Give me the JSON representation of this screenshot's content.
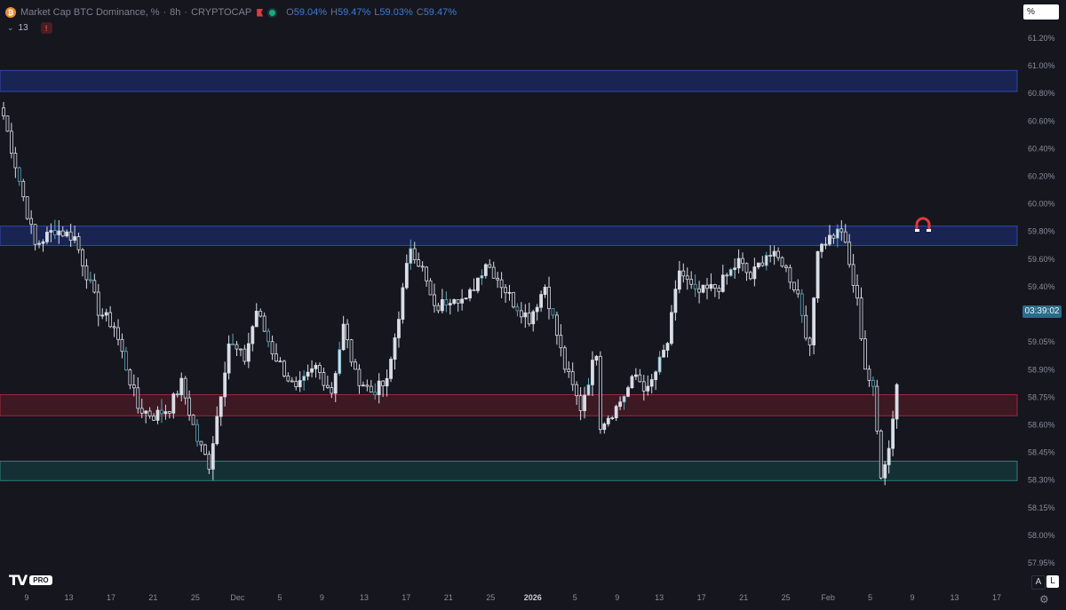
{
  "header": {
    "coin_glyph": "₿",
    "title": "Market Cap BTC Dominance, %",
    "separator_1": "·",
    "timeframe": "8h",
    "separator_2": "·",
    "exchange": "CRYPTOCAP",
    "ohlc": {
      "o_label": "O",
      "o_value": "59.04%",
      "h_label": "H",
      "h_value": "59.47%",
      "l_label": "L",
      "l_value": "59.03%",
      "c_label": "C",
      "c_value": "59.47%"
    },
    "indicator_count": "13",
    "warning_glyph": "!"
  },
  "scale_mode_label": "%",
  "current_price_label": "03:39:02",
  "logo": {
    "mark": "TV",
    "badge": "PRO"
  },
  "controls": {
    "auto_label": "A",
    "log_label": "L",
    "settings_glyph": "⚙"
  },
  "colors": {
    "background": "#15161e",
    "candle": "#d8dde6",
    "candle_dim": "#5fa5ba",
    "zone_blue_fill": "#1b2a66",
    "zone_blue_border": "#3046b0",
    "zone_red_fill": "#4a1b25",
    "zone_red_border": "#a02a36",
    "zone_teal_fill": "#16393c",
    "zone_teal_border": "#2f7f7e",
    "magnet": "#e0393e"
  },
  "chart_data": {
    "type": "candlestick",
    "title": "Market Cap BTC Dominance, %",
    "xlabel": "",
    "ylabel": "",
    "ylim": [
      57.85,
      61.3
    ],
    "y_ticks": [
      "61.20%",
      "61.00%",
      "60.80%",
      "60.60%",
      "60.40%",
      "60.20%",
      "60.00%",
      "59.80%",
      "59.60%",
      "59.40%",
      "59.20%",
      "59.05%",
      "58.90%",
      "58.75%",
      "58.60%",
      "58.45%",
      "58.30%",
      "58.15%",
      "58.00%",
      "57.95%"
    ],
    "x_ticks": [
      "9",
      "13",
      "17",
      "21",
      "25",
      "Dec",
      "5",
      "9",
      "13",
      "17",
      "21",
      "25",
      "2026",
      "5",
      "9",
      "13",
      "17",
      "21",
      "25",
      "Feb",
      "5",
      "9",
      "13",
      "17"
    ],
    "zones": [
      {
        "name": "resistance-top",
        "low": 60.9,
        "high": 61.03,
        "color": "blue"
      },
      {
        "name": "resistance-mid",
        "low": 59.95,
        "high": 60.07,
        "color": "blue"
      },
      {
        "name": "support-mid",
        "low": 58.9,
        "high": 59.03,
        "color": "red"
      },
      {
        "name": "support-low",
        "low": 58.5,
        "high": 58.62,
        "color": "teal"
      }
    ],
    "path_knots": [
      [
        0,
        60.75
      ],
      [
        4,
        60.35
      ],
      [
        8,
        59.95
      ],
      [
        13,
        60.05
      ],
      [
        18,
        60.0
      ],
      [
        24,
        59.55
      ],
      [
        28,
        59.45
      ],
      [
        34,
        58.95
      ],
      [
        38,
        58.9
      ],
      [
        42,
        58.95
      ],
      [
        45,
        59.1
      ],
      [
        49,
        58.75
      ],
      [
        52,
        58.6
      ],
      [
        57,
        59.35
      ],
      [
        61,
        59.25
      ],
      [
        64,
        59.55
      ],
      [
        68,
        59.3
      ],
      [
        74,
        59.05
      ],
      [
        79,
        59.2
      ],
      [
        83,
        59.05
      ],
      [
        86,
        59.45
      ],
      [
        89,
        59.15
      ],
      [
        93,
        59.05
      ],
      [
        97,
        59.1
      ],
      [
        103,
        59.95
      ],
      [
        106,
        59.8
      ],
      [
        109,
        59.55
      ],
      [
        114,
        59.65
      ],
      [
        117,
        59.6
      ],
      [
        122,
        59.85
      ],
      [
        125,
        59.75
      ],
      [
        129,
        59.6
      ],
      [
        133,
        59.5
      ],
      [
        137,
        59.7
      ],
      [
        142,
        59.2
      ],
      [
        146,
        58.95
      ],
      [
        150,
        59.3
      ],
      [
        151,
        58.85
      ],
      [
        155,
        58.95
      ],
      [
        160,
        59.15
      ],
      [
        163,
        59.05
      ],
      [
        168,
        59.35
      ],
      [
        171,
        59.8
      ],
      [
        175,
        59.65
      ],
      [
        181,
        59.7
      ],
      [
        186,
        59.85
      ],
      [
        189,
        59.75
      ],
      [
        193,
        59.9
      ],
      [
        197,
        59.85
      ],
      [
        201,
        59.65
      ],
      [
        204,
        59.3
      ],
      [
        206,
        59.95
      ],
      [
        212,
        60.05
      ],
      [
        216,
        59.6
      ],
      [
        218,
        59.2
      ],
      [
        220,
        59.05
      ],
      [
        222,
        58.55
      ],
      [
        224,
        58.7
      ],
      [
        226,
        59.1
      ]
    ]
  }
}
